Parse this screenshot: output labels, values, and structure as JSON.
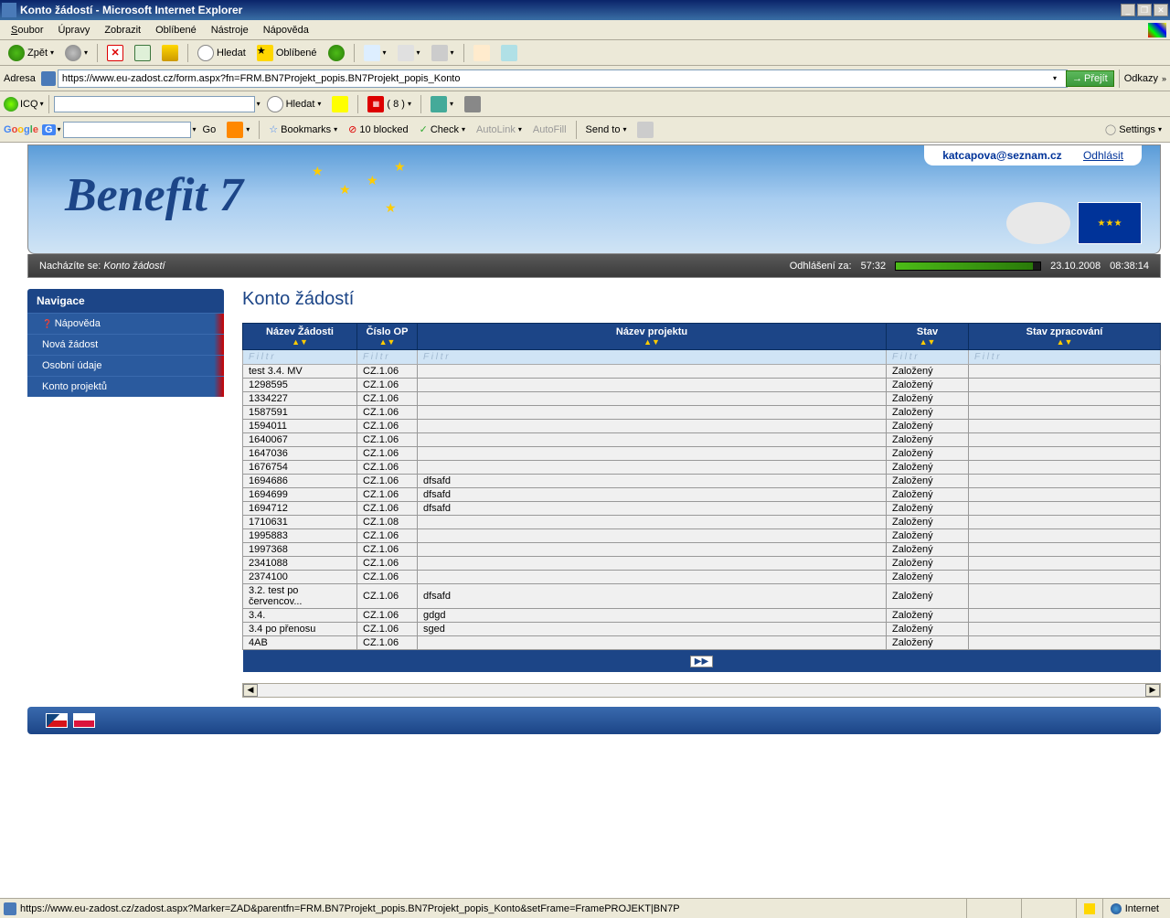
{
  "window": {
    "title": "Konto žádostí - Microsoft Internet Explorer"
  },
  "menu": {
    "file": "Soubor",
    "edit": "Úpravy",
    "view": "Zobrazit",
    "favorites": "Oblíbené",
    "tools": "Nástroje",
    "help": "Nápověda"
  },
  "toolbar": {
    "back": "Zpět",
    "search": "Hledat",
    "favorites": "Oblíbené",
    "go": "Přejít",
    "links": "Odkazy"
  },
  "address": {
    "label": "Adresa",
    "url": "https://www.eu-zadost.cz/form.aspx?fn=FRM.BN7Projekt_popis.BN7Projekt_popis_Konto"
  },
  "icq": {
    "label": "ICQ"
  },
  "icq_toolbar": {
    "search": "Hledat",
    "tabs": "( 8 )"
  },
  "google_toolbar": {
    "go": "Go",
    "bookmarks": "Bookmarks",
    "blocked": "10 blocked",
    "check": "Check",
    "autolink": "AutoLink",
    "autofill": "AutoFill",
    "send": "Send to",
    "settings": "Settings"
  },
  "banner": {
    "logo": "Benefit 7",
    "email": "katcapova@seznam.cz",
    "logout": "Odhlásit"
  },
  "statusbar": {
    "breadcrumb_label": "Nacházíte se:",
    "breadcrumb_value": "Konto žádostí",
    "logout_label": "Odhlášení za:",
    "logout_time": "57:32",
    "date": "23.10.2008",
    "time": "08:38:14"
  },
  "nav": {
    "header": "Navigace",
    "help": "Nápověda",
    "new_request": "Nová žádost",
    "personal": "Osobní údaje",
    "projects": "Konto projektů"
  },
  "page": {
    "title": "Konto žádostí"
  },
  "table": {
    "filter_placeholder": "F i l t r",
    "headers": {
      "name": "Název Žádosti",
      "op": "Číslo OP",
      "project": "Název projektu",
      "state": "Stav",
      "processing": "Stav zpracování"
    },
    "rows": [
      {
        "name": "test 3.4. MV",
        "op": "CZ.1.06",
        "project": "",
        "state": "Založený",
        "processing": ""
      },
      {
        "name": "1298595",
        "op": "CZ.1.06",
        "project": "",
        "state": "Založený",
        "processing": ""
      },
      {
        "name": "1334227",
        "op": "CZ.1.06",
        "project": "",
        "state": "Založený",
        "processing": ""
      },
      {
        "name": "1587591",
        "op": "CZ.1.06",
        "project": "",
        "state": "Založený",
        "processing": ""
      },
      {
        "name": "1594011",
        "op": "CZ.1.06",
        "project": "",
        "state": "Založený",
        "processing": ""
      },
      {
        "name": "1640067",
        "op": "CZ.1.06",
        "project": "",
        "state": "Založený",
        "processing": ""
      },
      {
        "name": "1647036",
        "op": "CZ.1.06",
        "project": "",
        "state": "Založený",
        "processing": ""
      },
      {
        "name": "1676754",
        "op": "CZ.1.06",
        "project": "",
        "state": "Založený",
        "processing": ""
      },
      {
        "name": "1694686",
        "op": "CZ.1.06",
        "project": "dfsafd",
        "state": "Založený",
        "processing": ""
      },
      {
        "name": "1694699",
        "op": "CZ.1.06",
        "project": "dfsafd",
        "state": "Založený",
        "processing": ""
      },
      {
        "name": "1694712",
        "op": "CZ.1.06",
        "project": "dfsafd",
        "state": "Založený",
        "processing": ""
      },
      {
        "name": "1710631",
        "op": "CZ.1.08",
        "project": "",
        "state": "Založený",
        "processing": ""
      },
      {
        "name": "1995883",
        "op": "CZ.1.06",
        "project": "",
        "state": "Založený",
        "processing": ""
      },
      {
        "name": "1997368",
        "op": "CZ.1.06",
        "project": "",
        "state": "Založený",
        "processing": ""
      },
      {
        "name": "2341088",
        "op": "CZ.1.06",
        "project": "",
        "state": "Založený",
        "processing": ""
      },
      {
        "name": "2374100",
        "op": "CZ.1.06",
        "project": "",
        "state": "Založený",
        "processing": ""
      },
      {
        "name": "3.2. test po červencov...",
        "op": "CZ.1.06",
        "project": "dfsafd",
        "state": "Založený",
        "processing": ""
      },
      {
        "name": "3.4.",
        "op": "CZ.1.06",
        "project": "gdgd",
        "state": "Založený",
        "processing": ""
      },
      {
        "name": "3.4 po přenosu",
        "op": "CZ.1.06",
        "project": "sged",
        "state": "Založený",
        "processing": ""
      },
      {
        "name": "4AB",
        "op": "CZ.1.06",
        "project": "",
        "state": "Založený",
        "processing": ""
      }
    ]
  },
  "ie_status": {
    "text": "https://www.eu-zadost.cz/zadost.aspx?Marker=ZAD&parentfn=FRM.BN7Projekt_popis.BN7Projekt_popis_Konto&setFrame=FramePROJEKT|BN7P",
    "zone": "Internet"
  }
}
